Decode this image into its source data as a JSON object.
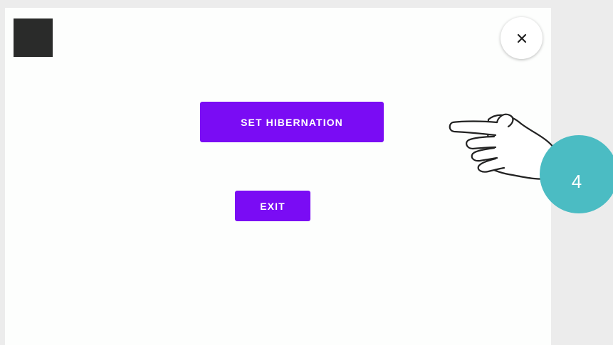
{
  "dialog": {
    "primary_button_label": "SET HIBERNATION",
    "exit_button_label": "EXIT",
    "close_icon": "close-icon"
  },
  "tutorial": {
    "pointer_icon": "pointing-hand-icon",
    "step_number": "4"
  },
  "colors": {
    "button_bg": "#7a0cf4",
    "button_text": "#ffffff",
    "badge_bg": "#4bbcc3",
    "screen_bg": "#fdfefd",
    "outer_bg": "#ececec"
  }
}
